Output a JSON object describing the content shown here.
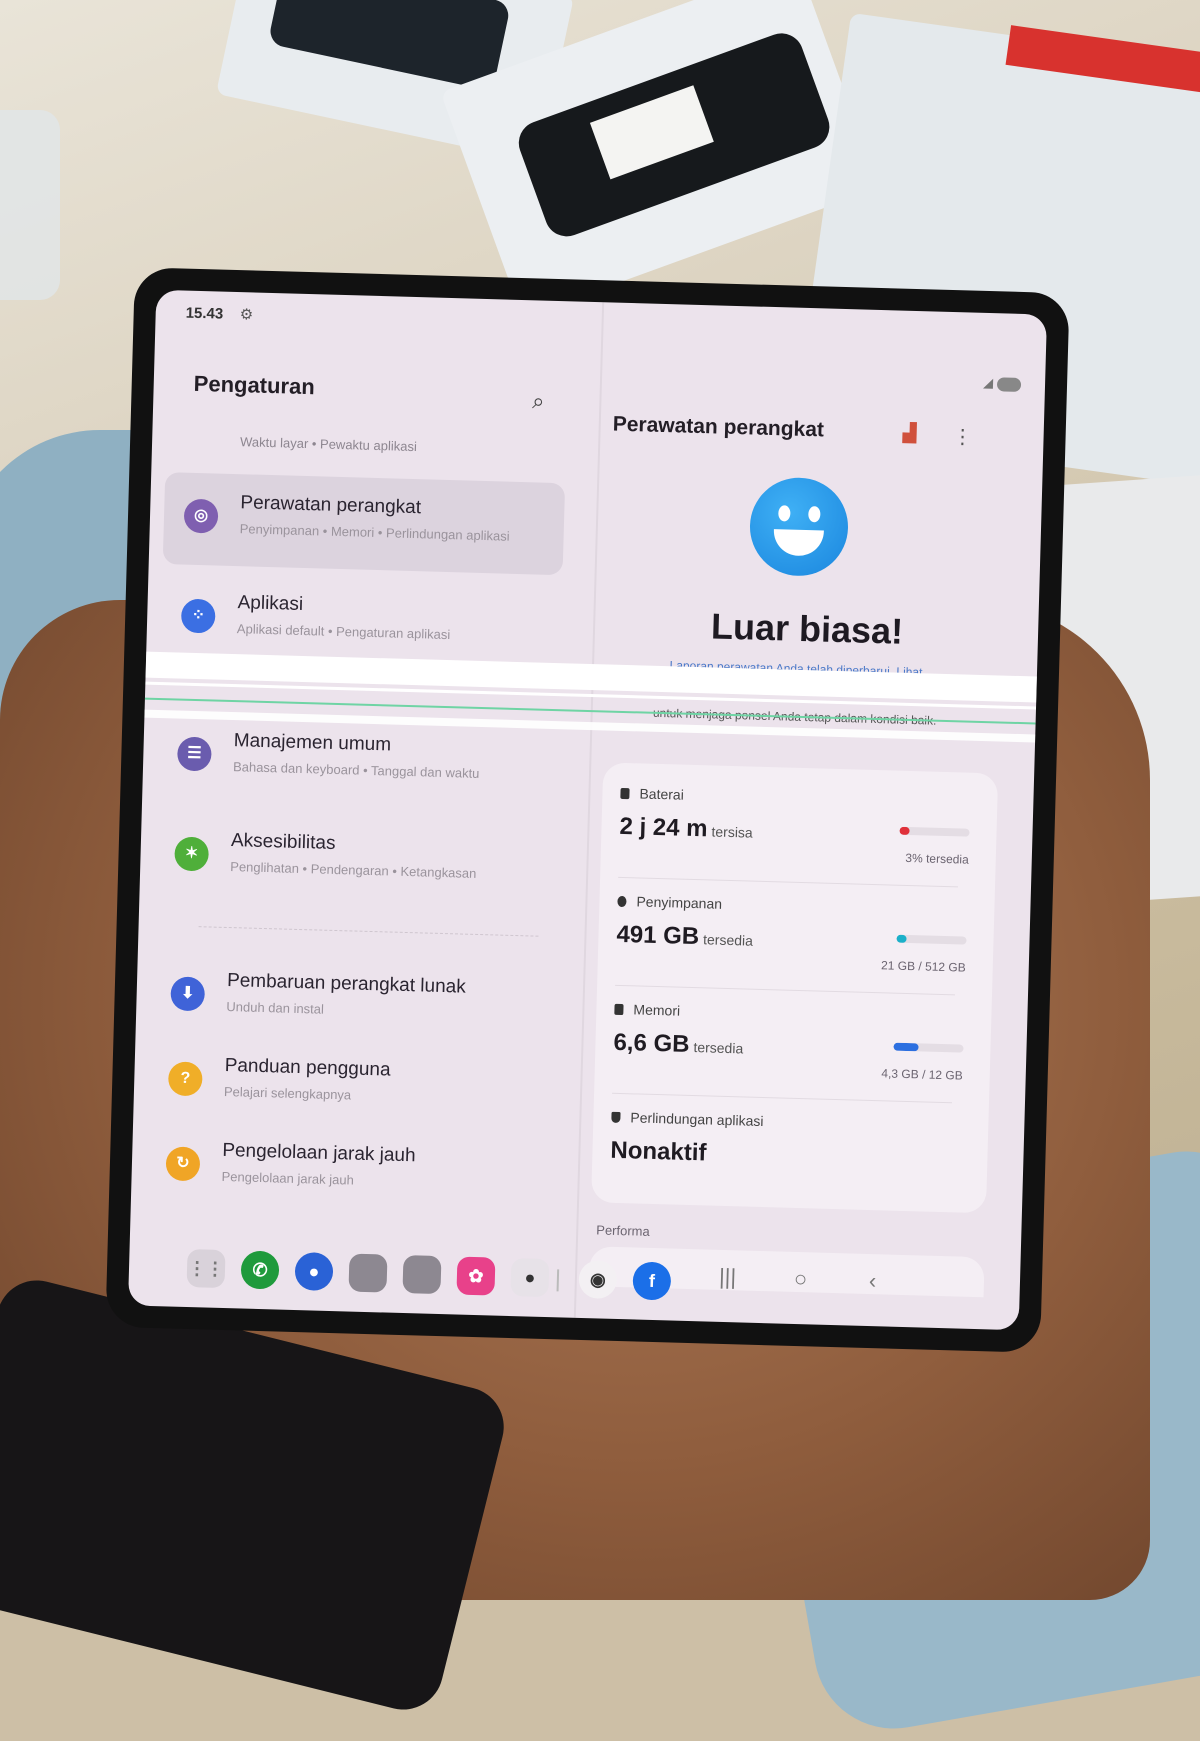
{
  "status": {
    "time": "15.43"
  },
  "left": {
    "title": "Pengaturan",
    "top_subtitle": "Waktu layar  •  Pewaktu aplikasi",
    "items": [
      {
        "title": "Perawatan perangkat",
        "sub": "Penyimpanan  •  Memori  •  Perlindungan aplikasi",
        "icon": "device-care-icon",
        "color": "#7f5fb0",
        "selected": true
      },
      {
        "title": "Aplikasi",
        "sub": "Aplikasi default  •  Pengaturan aplikasi",
        "icon": "apps-icon",
        "color": "#3b6fe3"
      },
      {
        "title": "Manajemen umum",
        "sub": "Bahasa dan keyboard  •  Tanggal dan waktu",
        "icon": "general-management-icon",
        "color": "#6a5cae"
      },
      {
        "title": "Aksesibilitas",
        "sub": "Penglihatan  •  Pendengaran  •  Ketangkasan",
        "icon": "accessibility-icon",
        "color": "#4faf3a"
      },
      {
        "title": "Pembaruan perangkat lunak",
        "sub": "Unduh dan instal",
        "icon": "software-update-icon",
        "color": "#3f63d8"
      },
      {
        "title": "Panduan pengguna",
        "sub": "Pelajari selengkapnya",
        "icon": "user-manual-icon",
        "color": "#f0ae28"
      },
      {
        "title": "Pengelolaan jarak jauh",
        "sub": "Pengelolaan jarak jauh",
        "icon": "remote-management-icon",
        "color": "#f0a526"
      }
    ]
  },
  "right": {
    "title": "Perawatan perangkat",
    "hero": "Luar biasa!",
    "report_text": "Laporan perawatan Anda telah diperbarui. Lihat",
    "report_tail": "untuk menjaga ponsel Anda tetap dalam kondisi baik.",
    "battery": {
      "label": "Baterai",
      "value": "2 j 24 m",
      "unit": "tersisa",
      "caption": "3% tersedia",
      "fraction": 0.03,
      "color": "#e0303a"
    },
    "storage": {
      "label": "Penyimpanan",
      "value": "491 GB",
      "unit": "tersedia",
      "caption": "21 GB / 512 GB",
      "fraction": 0.04,
      "color": "#1bb0c9"
    },
    "memory": {
      "label": "Memori",
      "value": "6,6 GB",
      "unit": "tersedia",
      "caption": "4,3 GB / 12 GB",
      "fraction": 0.36,
      "color": "#2c6fe0"
    },
    "protection": {
      "label": "Perlindungan aplikasi",
      "value": "Nonaktif"
    },
    "performa_label": "Performa"
  },
  "dock": [
    {
      "name": "app-drawer-icon",
      "color": "#d9d2da",
      "glyph": "⋮⋮"
    },
    {
      "name": "phone-app-icon",
      "color": "#1f9a3c",
      "glyph": "✆"
    },
    {
      "name": "messages-app-icon",
      "color": "#2a62d6",
      "glyph": "●"
    },
    {
      "name": "gallery-folder-icon",
      "color": "#8d8891",
      "glyph": ""
    },
    {
      "name": "tools-folder-icon",
      "color": "#8d8891",
      "glyph": ""
    },
    {
      "name": "flower-gallery-icon",
      "color": "#e8418a",
      "glyph": "✿"
    },
    {
      "name": "camera-app-icon",
      "color": "#e7e2e8",
      "glyph": "●"
    },
    {
      "name": "chrome-app-icon",
      "color": "#f3f0f3",
      "glyph": "◉"
    },
    {
      "name": "facebook-app-icon",
      "color": "#1b6fe8",
      "glyph": "f"
    }
  ]
}
